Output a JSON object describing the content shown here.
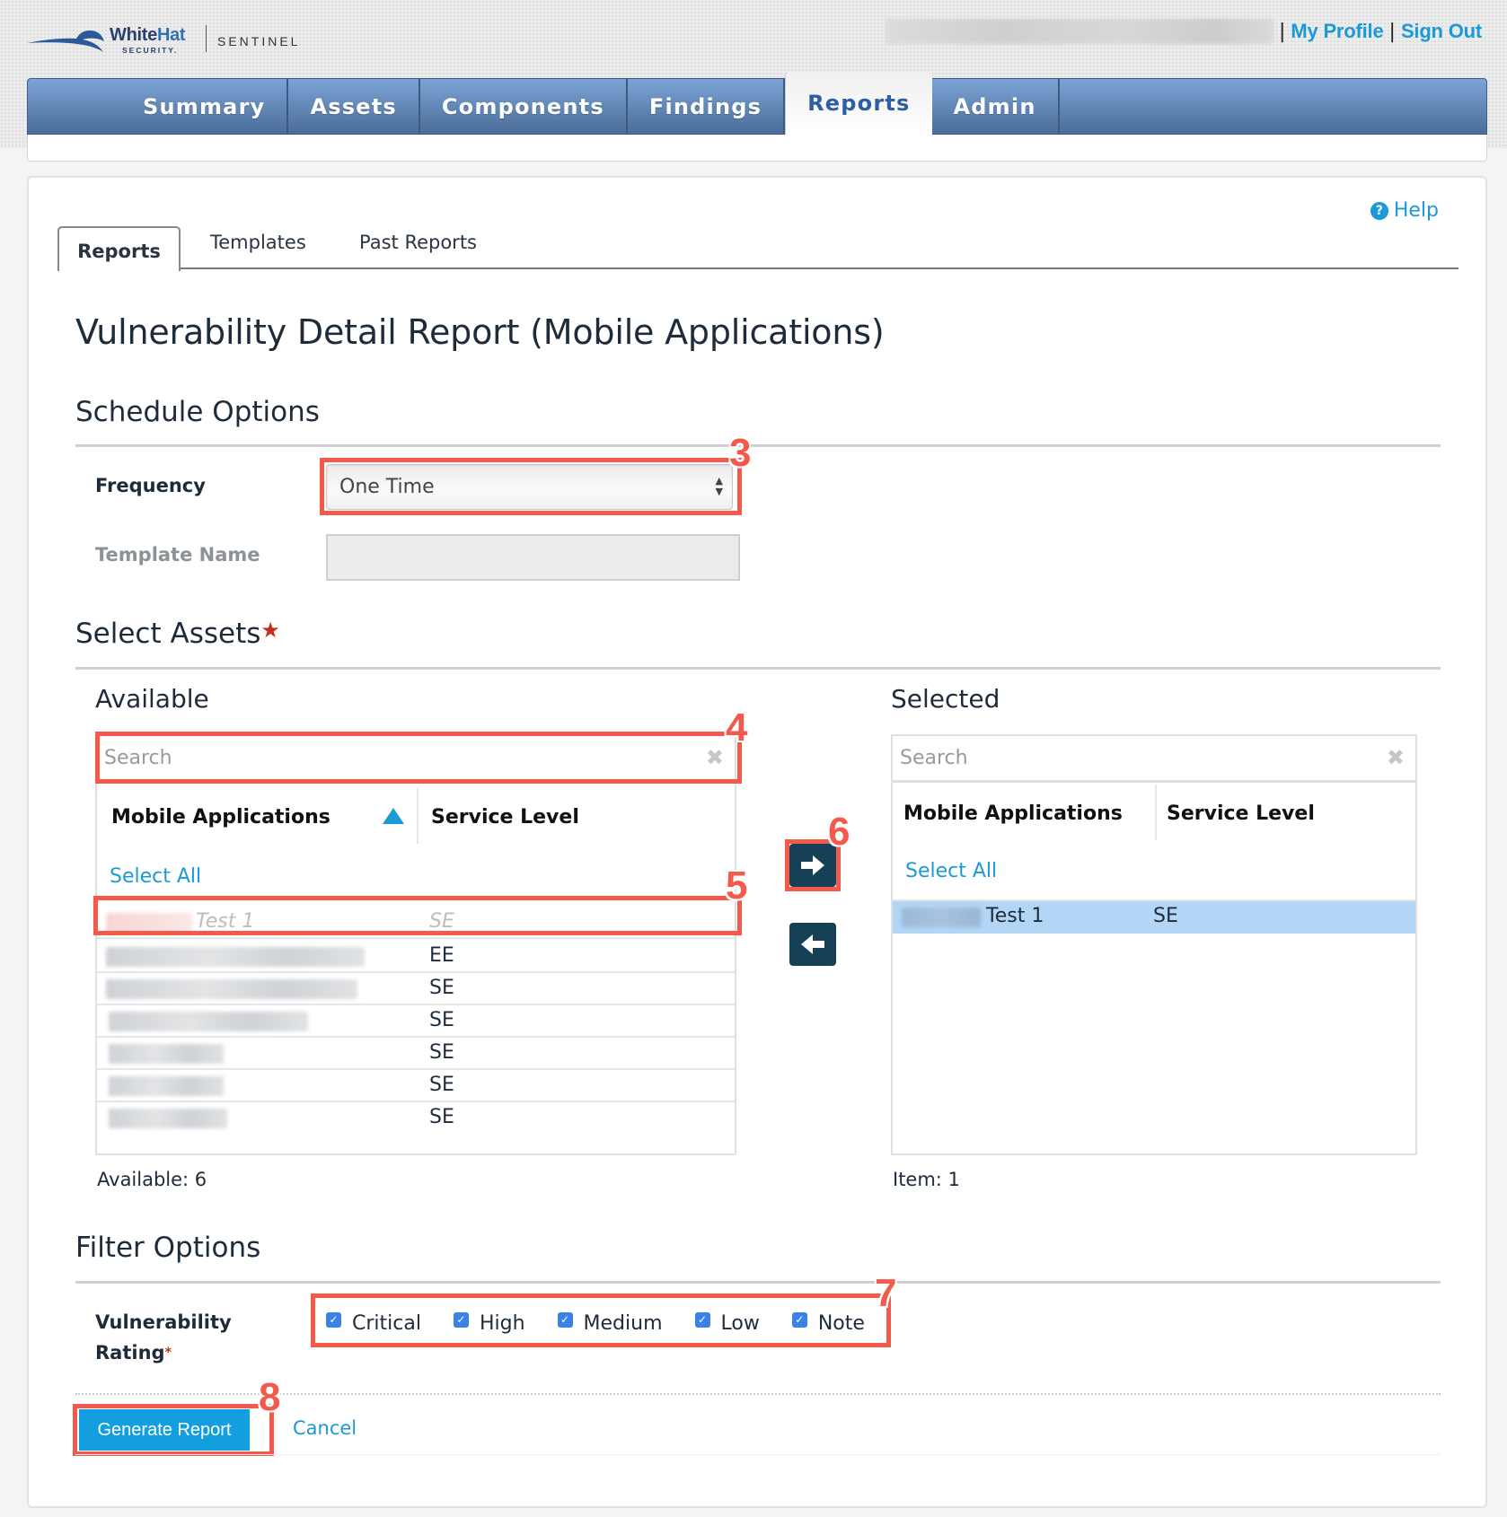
{
  "header": {
    "logo_brand_part1": "White",
    "logo_brand_part2": "Hat",
    "logo_sub": "SECURITY.",
    "logo_product": "SENTINEL",
    "user_links": [
      {
        "label": "My Profile"
      },
      {
        "label": "Sign Out"
      }
    ],
    "nav": [
      {
        "label": "Summary",
        "active": false
      },
      {
        "label": "Assets",
        "active": false
      },
      {
        "label": "Components",
        "active": false
      },
      {
        "label": "Findings",
        "active": false
      },
      {
        "label": "Reports",
        "active": true
      },
      {
        "label": "Admin",
        "active": false
      }
    ]
  },
  "help": {
    "icon": "question-circle-icon",
    "label": "Help"
  },
  "tabs": [
    {
      "label": "Reports",
      "active": true
    },
    {
      "label": "Templates",
      "active": false
    },
    {
      "label": "Past Reports",
      "active": false
    }
  ],
  "page_title": "Vulnerability Detail Report (Mobile Applications)",
  "schedule": {
    "heading": "Schedule Options",
    "frequency_label": "Frequency",
    "frequency_value": "One Time",
    "template_name_label": "Template Name",
    "template_name_value": ""
  },
  "assets": {
    "heading": "Select Assets",
    "required_mark": "★",
    "available": {
      "heading": "Available",
      "search_placeholder": "Search",
      "col_name": "Mobile Applications",
      "col_level": "Service Level",
      "select_all": "Select All",
      "rows": [
        {
          "name": "Test 1",
          "level": "SE",
          "disabled": true
        },
        {
          "name": "",
          "level": "EE",
          "disabled": false
        },
        {
          "name": "",
          "level": "SE",
          "disabled": false
        },
        {
          "name": "",
          "level": "SE",
          "disabled": false
        },
        {
          "name": "",
          "level": "SE",
          "disabled": false
        },
        {
          "name": "",
          "level": "SE",
          "disabled": false
        },
        {
          "name": "",
          "level": "SE",
          "disabled": false
        }
      ],
      "count_label": "Available: 6"
    },
    "selected": {
      "heading": "Selected",
      "search_placeholder": "Search",
      "col_name": "Mobile Applications",
      "col_level": "Service Level",
      "select_all": "Select All",
      "rows": [
        {
          "name": "Test 1",
          "level": "SE",
          "highlighted": true
        }
      ],
      "count_label": "Item: 1"
    },
    "move_right_icon": "arrow-right-icon",
    "move_left_icon": "arrow-left-icon"
  },
  "filter": {
    "heading": "Filter Options",
    "rating_label_line1": "Vulnerability",
    "rating_label_line2": "Rating",
    "required_mark": "*",
    "options": [
      {
        "label": "Critical",
        "checked": true
      },
      {
        "label": "High",
        "checked": true
      },
      {
        "label": "Medium",
        "checked": true
      },
      {
        "label": "Low",
        "checked": true
      },
      {
        "label": "Note",
        "checked": true
      }
    ]
  },
  "actions": {
    "generate": "Generate Report",
    "cancel": "Cancel"
  },
  "annotations": [
    "3",
    "4",
    "5",
    "6",
    "7",
    "8"
  ],
  "colors": {
    "accent": "#1a9ad6",
    "annotation": "#f35a4c",
    "nav_top": "#7ba4d5",
    "nav_bottom": "#4b6d99",
    "arrow_button": "#154056",
    "selected_row": "#b3d6f7"
  }
}
